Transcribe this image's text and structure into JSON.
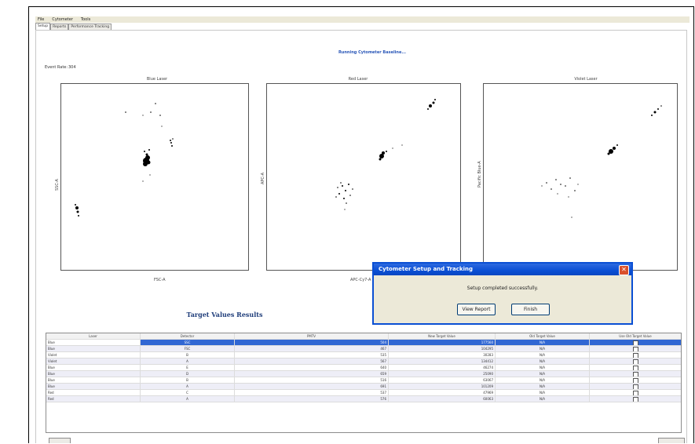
{
  "menu": {
    "file": "File",
    "cytometer": "Cytometer",
    "tools": "Tools"
  },
  "tabs": [
    "Setup",
    "Reports",
    "Performance Tracking"
  ],
  "status_title": "Running Cytometer Baseline...",
  "event_rate": {
    "label": "Event Rate:",
    "value": "304"
  },
  "plots": [
    {
      "title": "Blue Laser",
      "ylabel": "SSC-A",
      "xlabel": "FSC-A"
    },
    {
      "title": "Red Laser",
      "ylabel": "APC-A",
      "xlabel": "APC-Cy7-A"
    },
    {
      "title": "Violet Laser",
      "ylabel": "Pacific Blue-A",
      "xlabel": ""
    }
  ],
  "results_title": "Target Values Results",
  "table": {
    "columns": [
      "Laser",
      "Detector",
      "PMTV",
      "New Target Value",
      "Old Target Value",
      "Use Old Target Value"
    ],
    "rows": [
      [
        "Blue",
        "SSC",
        "504",
        "177560",
        "N/A"
      ],
      [
        "Blue",
        "FSC",
        "467",
        "104295",
        "N/A"
      ],
      [
        "Violet",
        "B",
        "535",
        "30283",
        "N/A"
      ],
      [
        "Violet",
        "A",
        "567",
        "134412",
        "N/A"
      ],
      [
        "Blue",
        "E",
        "640",
        "46274",
        "N/A"
      ],
      [
        "Blue",
        "D",
        "659",
        "25090",
        "N/A"
      ],
      [
        "Blue",
        "B",
        "516",
        "63067",
        "N/A"
      ],
      [
        "Blue",
        "A",
        "691",
        "101209",
        "N/A"
      ],
      [
        "Red",
        "C",
        "537",
        "47969",
        "N/A"
      ],
      [
        "Red",
        "A",
        "576",
        "60063",
        "N/A"
      ]
    ]
  },
  "dialog": {
    "title": "Cytometer Setup and Tracking",
    "message": "Setup completed successfully.",
    "view_report": "View Report",
    "finish": "Finish"
  },
  "colors": {
    "accent": "#0a4fd4",
    "selection": "#3167d3",
    "title_blue": "#2a57b8"
  }
}
